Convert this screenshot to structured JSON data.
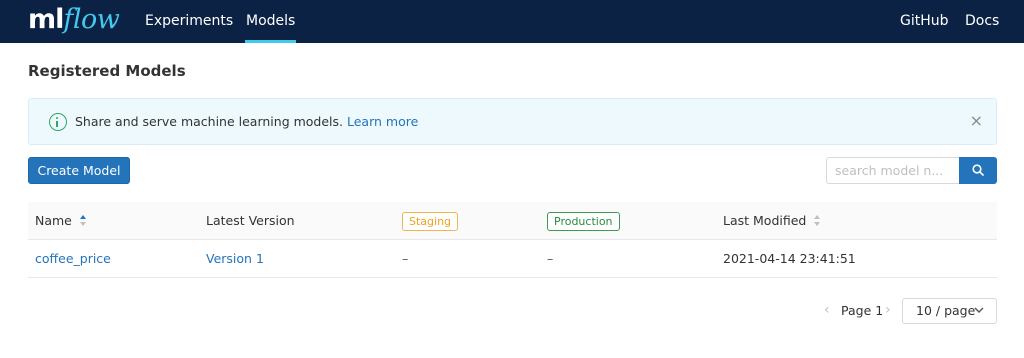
{
  "brand": {
    "logo_ml": "ml",
    "logo_flow": "flow"
  },
  "nav": {
    "experiments": "Experiments",
    "models": "Models",
    "github": "GitHub",
    "docs": "Docs"
  },
  "page": {
    "title": "Registered Models"
  },
  "banner": {
    "message": "Share and serve machine learning models.",
    "link": "Learn more",
    "close": "×",
    "icon": "info-circle-icon"
  },
  "toolbar": {
    "create_label": "Create Model",
    "search_placeholder": "search model n...",
    "search_icon": "search-icon"
  },
  "table": {
    "columns": {
      "name": "Name",
      "latest": "Latest Version",
      "staging": "Staging",
      "production": "Production",
      "modified": "Last Modified"
    },
    "rows": [
      {
        "name": "coffee_price",
        "latest": "Version 1",
        "staging": "–",
        "production": "–",
        "modified": "2021-04-14 23:41:51"
      }
    ]
  },
  "pagination": {
    "page_label": "Page 1",
    "prev": "‹",
    "next": "›",
    "page_size": "10 / page"
  },
  "colors": {
    "nav_bg": "#0b2244",
    "accent": "#43c9ed",
    "primary": "#2374bb",
    "staging": "#f0a020",
    "production": "#2b8a3e"
  }
}
